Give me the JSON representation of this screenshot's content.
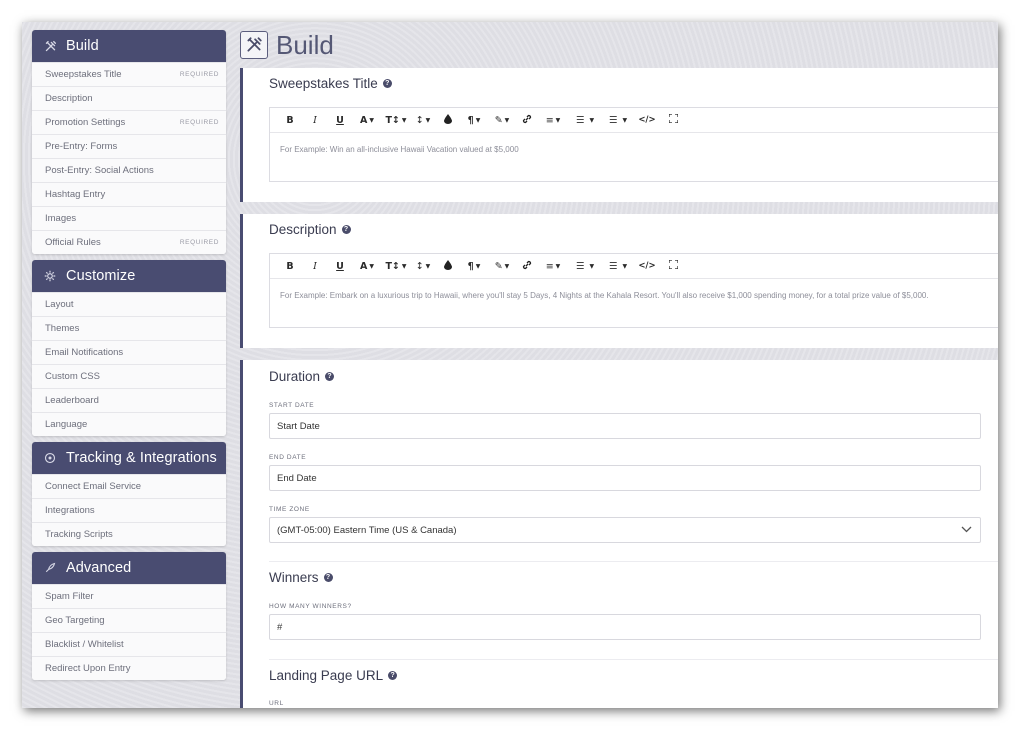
{
  "sidebar": {
    "build": {
      "title": "Build",
      "icon": "tools-icon",
      "items": [
        {
          "label": "Sweepstakes Title",
          "badge": "REQUIRED"
        },
        {
          "label": "Description",
          "badge": ""
        },
        {
          "label": "Promotion Settings",
          "badge": "REQUIRED"
        },
        {
          "label": "Pre-Entry: Forms",
          "badge": ""
        },
        {
          "label": "Post-Entry: Social Actions",
          "badge": ""
        },
        {
          "label": "Hashtag Entry",
          "badge": ""
        },
        {
          "label": "Images",
          "badge": ""
        },
        {
          "label": "Official Rules",
          "badge": "REQUIRED"
        }
      ]
    },
    "customize": {
      "title": "Customize",
      "icon": "gear-icon",
      "items": [
        {
          "label": "Layout"
        },
        {
          "label": "Themes"
        },
        {
          "label": "Email Notifications"
        },
        {
          "label": "Custom CSS"
        },
        {
          "label": "Leaderboard"
        },
        {
          "label": "Language"
        }
      ]
    },
    "tracking": {
      "title": "Tracking & Integrations",
      "icon": "target-icon",
      "items": [
        {
          "label": "Connect Email Service"
        },
        {
          "label": "Integrations"
        },
        {
          "label": "Tracking Scripts"
        }
      ]
    },
    "advanced": {
      "title": "Advanced",
      "icon": "rocket-icon",
      "items": [
        {
          "label": "Spam Filter"
        },
        {
          "label": "Geo Targeting"
        },
        {
          "label": "Blacklist / Whitelist"
        },
        {
          "label": "Redirect Upon Entry"
        }
      ]
    }
  },
  "page": {
    "title": "Build",
    "icon": "tools-icon"
  },
  "panels": {
    "title_panel": {
      "heading": "Sweepstakes Title",
      "placeholder": "For Example: Win an all-inclusive Hawaii Vacation valued at $5,000"
    },
    "description_panel": {
      "heading": "Description",
      "placeholder": "For Example: Embark on a luxurious trip to Hawaii, where you'll stay 5 Days, 4 Nights at the Kahala Resort. You'll also receive $1,000 spending money, for a total prize value of $5,000."
    },
    "duration": {
      "heading": "Duration",
      "start_label": "START DATE",
      "start_placeholder": "Start Date",
      "end_label": "END DATE",
      "end_placeholder": "End Date",
      "tz_label": "TIME ZONE",
      "tz_value": "(GMT-05:00) Eastern Time (US & Canada)"
    },
    "winners": {
      "heading": "Winners",
      "label": "HOW MANY WINNERS?",
      "placeholder": "#"
    },
    "landing": {
      "heading": "Landing Page URL",
      "label": "URL"
    }
  },
  "toolbar": {
    "bold": "B",
    "italic": "I",
    "underline": "U",
    "font": "A",
    "size": "T↕",
    "line_height": "↕",
    "color": "●",
    "paragraph": "¶",
    "style": "✎",
    "link": "⚭",
    "align": "≡",
    "ordered": "☰",
    "unordered": "☰",
    "code": "</>",
    "fullscreen": "⛶"
  },
  "colors": {
    "accent": "#494c71",
    "background": "#e2e2e8"
  }
}
